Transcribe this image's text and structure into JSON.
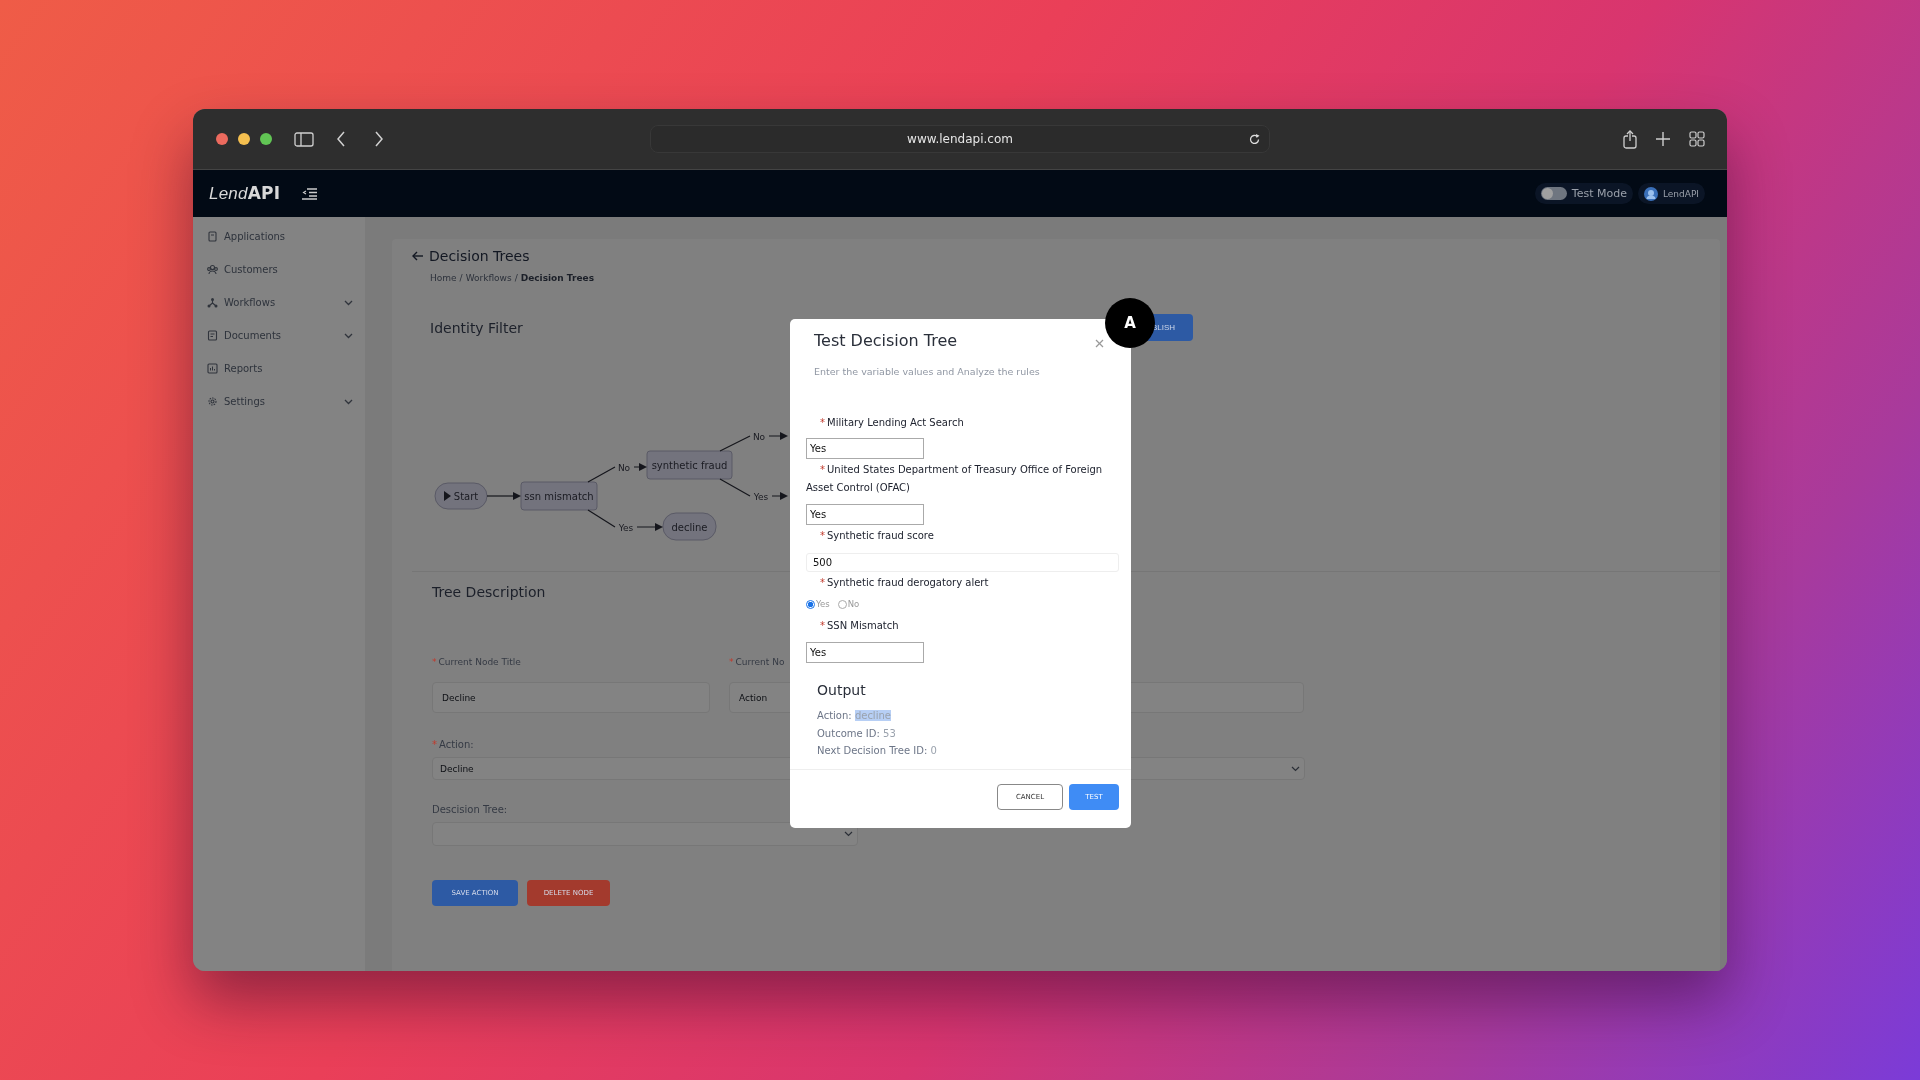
{
  "browser": {
    "url": "www.lendapi.com"
  },
  "header": {
    "logo": {
      "light": "Lend",
      "strong": "API"
    },
    "test_mode": {
      "label": "Test Mode",
      "on": false
    },
    "account": {
      "label": "LendAPI"
    }
  },
  "sidebar": {
    "items": [
      {
        "label": "Applications",
        "expandable": false
      },
      {
        "label": "Customers",
        "expandable": false
      },
      {
        "label": "Workflows",
        "expandable": true
      },
      {
        "label": "Documents",
        "expandable": true
      },
      {
        "label": "Reports",
        "expandable": false
      },
      {
        "label": "Settings",
        "expandable": true
      }
    ]
  },
  "page": {
    "title": "Decision Trees",
    "breadcrumb": [
      {
        "kind": "link",
        "label": "Home"
      },
      {
        "kind": "separator",
        "label": "/"
      },
      {
        "kind": "link",
        "label": "Workflows"
      },
      {
        "kind": "separator",
        "label": "/"
      },
      {
        "kind": "current",
        "label": "Decision Trees"
      }
    ],
    "tree_title": "Identity Filter",
    "publish_button": {
      "label": "BLISH"
    },
    "diagram": {
      "nodes": [
        {
          "label": "Start",
          "kind": "start"
        },
        {
          "label": "ssn mismatch",
          "kind": "box"
        },
        {
          "label": "synthetic fraud",
          "kind": "box"
        },
        {
          "label": "decline",
          "kind": "end"
        }
      ],
      "edges": [
        {
          "kind": "plain"
        },
        {
          "kind": "labeled",
          "label": "No"
        },
        {
          "kind": "labeled",
          "label": "Yes"
        },
        {
          "kind": "labeled",
          "label": "No"
        },
        {
          "kind": "labeled",
          "label": "Yes"
        }
      ]
    },
    "tree_description": {
      "title": "Tree Description",
      "fields": [
        {
          "kind": "input",
          "required_mark": "*",
          "label": "Current Node Title",
          "value": "Decline"
        },
        {
          "kind": "input",
          "required_mark": "*",
          "label": "Current No",
          "value": "Action"
        },
        {
          "kind": "input"
        }
      ],
      "action": {
        "required_mark": "*",
        "label": "Action:",
        "value": "Decline"
      },
      "decision_tree": {
        "label": "Descision Tree:"
      },
      "buttons": [
        {
          "label": "SAVE ACTION",
          "kind": "primary"
        },
        {
          "label": "DELETE NODE",
          "kind": "danger"
        }
      ]
    }
  },
  "modal": {
    "title": "Test Decision Tree",
    "subtitle": "Enter the variable values and Analyze the rules",
    "fields": [
      {
        "required_mark": "*",
        "label": "Military Lending Act Search",
        "kind": "short-input",
        "value": "Yes"
      },
      {
        "required_mark": "*",
        "label": "United States Department of Treasury Office of Foreign Asset Control (OFAC)",
        "kind": "short-input",
        "value": "Yes"
      },
      {
        "required_mark": "*",
        "label": "Synthetic fraud score",
        "kind": "wide-input",
        "value": "500"
      },
      {
        "required_mark": "*",
        "label": "Synthetic fraud derogatory alert",
        "kind": "radio",
        "options": [
          {
            "label": "Yes",
            "selected": true
          },
          {
            "label": "No",
            "selected": false
          }
        ]
      },
      {
        "required_mark": "*",
        "label": "SSN Mismatch",
        "kind": "short-input",
        "value": "Yes"
      }
    ],
    "output": {
      "title": "Output",
      "lines": [
        {
          "label": "Action:",
          "value": "decline",
          "highlighted": true
        },
        {
          "label": "Outcome ID:",
          "value": "53",
          "highlighted": false
        },
        {
          "label": "Next Decision Tree ID:",
          "value": "0",
          "highlighted": false
        }
      ]
    },
    "buttons": [
      {
        "label": "CANCEL",
        "kind": "secondary"
      },
      {
        "label": "TEST",
        "kind": "primary"
      }
    ]
  },
  "badge": "A"
}
